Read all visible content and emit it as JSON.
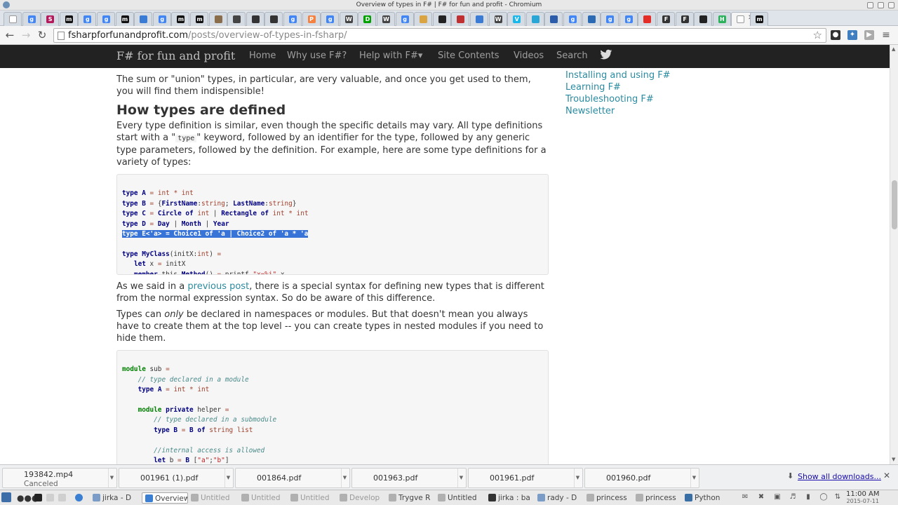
{
  "window": {
    "title": "Overview of types in F# | F# for fun and profit - Chromium"
  },
  "tabs": [
    {
      "favicon_color": "#ffffff",
      "favicon_icon": "page-icon"
    },
    {
      "favicon_color": "#4285f4",
      "favicon_icon": "google-icon",
      "letter": "g"
    },
    {
      "favicon_color": "#b3195b",
      "favicon_icon": "s-icon",
      "letter": "S"
    },
    {
      "favicon_color": "#111111",
      "favicon_icon": "m-icon",
      "letter": "m"
    },
    {
      "favicon_color": "#4285f4",
      "favicon_icon": "google-icon",
      "letter": "g"
    },
    {
      "favicon_color": "#4285f4",
      "favicon_icon": "google-icon",
      "letter": "g"
    },
    {
      "favicon_color": "#111111",
      "favicon_icon": "m-icon",
      "letter": "m"
    },
    {
      "favicon_color": "#3a7bd5",
      "favicon_icon": "tool-icon",
      "letter": ""
    },
    {
      "favicon_color": "#4285f4",
      "favicon_icon": "google-icon",
      "letter": "g"
    },
    {
      "favicon_color": "#111111",
      "favicon_icon": "m-icon",
      "letter": "m"
    },
    {
      "favicon_color": "#111111",
      "favicon_icon": "m-icon",
      "letter": "m"
    },
    {
      "favicon_color": "#8a6d4b",
      "favicon_icon": "person-icon",
      "letter": ""
    },
    {
      "favicon_color": "#444444",
      "favicon_icon": "gear-icon",
      "letter": ""
    },
    {
      "favicon_color": "#333333",
      "favicon_icon": "feather-icon",
      "letter": ""
    },
    {
      "favicon_color": "#333333",
      "favicon_icon": "feather-icon",
      "letter": ""
    },
    {
      "favicon_color": "#4285f4",
      "favicon_icon": "google-icon",
      "letter": "g"
    },
    {
      "favicon_color": "#f4813f",
      "favicon_icon": "p-icon",
      "letter": "P"
    },
    {
      "favicon_color": "#4285f4",
      "favicon_icon": "google-icon",
      "letter": "g"
    },
    {
      "favicon_color": "#444444",
      "favicon_icon": "w-icon",
      "letter": "W"
    },
    {
      "favicon_color": "#00a000",
      "favicon_icon": "d-icon",
      "letter": "D"
    },
    {
      "favicon_color": "#444444",
      "favicon_icon": "w-icon",
      "letter": "W"
    },
    {
      "favicon_color": "#4285f4",
      "favicon_icon": "google-icon",
      "letter": "g"
    },
    {
      "favicon_color": "#d9a441",
      "favicon_icon": "hat-icon",
      "letter": ""
    },
    {
      "favicon_color": "#222222",
      "favicon_icon": "github-icon",
      "letter": ""
    },
    {
      "favicon_color": "#c03030",
      "favicon_icon": "slash-icon",
      "letter": ""
    },
    {
      "favicon_color": "#3a7bd5",
      "favicon_icon": "swirl-icon",
      "letter": ""
    },
    {
      "favicon_color": "#444444",
      "favicon_icon": "w-icon",
      "letter": "W"
    },
    {
      "favicon_color": "#1ab7ea",
      "favicon_icon": "v-icon",
      "letter": "V"
    },
    {
      "favicon_color": "#2aa6d6",
      "favicon_icon": "pause-icon",
      "letter": ""
    },
    {
      "favicon_color": "#2a5caa",
      "favicon_icon": "blob-icon",
      "letter": ""
    },
    {
      "favicon_color": "#4285f4",
      "favicon_icon": "google-icon",
      "letter": "g"
    },
    {
      "favicon_color": "#2a6ab5",
      "favicon_icon": "doc-icon",
      "letter": ""
    },
    {
      "favicon_color": "#4285f4",
      "favicon_icon": "google-icon",
      "letter": "g"
    },
    {
      "favicon_color": "#4285f4",
      "favicon_icon": "google-icon",
      "letter": "g"
    },
    {
      "favicon_color": "#e52d27",
      "favicon_icon": "youtube-icon",
      "letter": ""
    },
    {
      "favicon_color": "#333333",
      "favicon_icon": "fs-icon",
      "letter": "F"
    },
    {
      "favicon_color": "#333333",
      "favicon_icon": "fs-icon",
      "letter": "F"
    },
    {
      "favicon_color": "#222222",
      "favicon_icon": "github-icon",
      "letter": ""
    },
    {
      "favicon_color": "#2ab25a",
      "favicon_icon": "h-icon",
      "letter": "H"
    },
    {
      "favicon_color": "#ffffff",
      "favicon_icon": "active-tab-icon",
      "letter": "",
      "active": true
    },
    {
      "favicon_color": "#111111",
      "favicon_icon": "m-icon",
      "letter": "m"
    }
  ],
  "toolbar": {
    "url_domain": "fsharpforfunandprofit.com",
    "url_path": "/posts/overview-of-types-in-fsharp/",
    "back_icon": "back-arrow-icon",
    "forward_icon": "forward-arrow-icon",
    "reload_icon": "reload-icon",
    "star_icon": "star-icon",
    "extensions": [
      {
        "icon": "pocket-icon",
        "color": "#333333"
      },
      {
        "icon": "tools-icon",
        "color": "#3f7fc0"
      },
      {
        "icon": "megaphone-icon",
        "color": "#aaaaaa"
      },
      {
        "icon": "menu-icon",
        "color": "#555555"
      }
    ]
  },
  "site": {
    "brand": "F# for fun and profit",
    "nav": [
      "Home",
      "Why use F#?",
      "Help with F#▾",
      "Site Contents",
      "Videos",
      "Search"
    ],
    "twitter_icon": "twitter-icon"
  },
  "article": {
    "p1": "The sum or \"union\" types, in particular, are very valuable, and once you get used to them, you will find them indispensible!",
    "heading": "How types are defined",
    "p2_before": "Every type definition is similar, even though the specific details may vary. All type definitions start with a \"",
    "p2_kw": "type",
    "p2_after": "\" keyword, followed by an identifier for the type, followed by any generic type parameters, followed by the definition. For example, here are some type definitions for a variety of types:",
    "p3_before": "As we said in a ",
    "p3_link": "previous post",
    "p3_after": ", there is a special syntax for defining new types that is different from the normal expression syntax. So do be aware of this difference.",
    "p4_before": "Types can ",
    "p4_em": "only",
    "p4_after": " be declared in namespaces or modules. But that doesn't mean you always have to create them at the top level -- you can create types in nested modules if you need to hide them."
  },
  "sidebar": {
    "links": [
      "Installing and using F#",
      "Learning F#",
      "Troubleshooting F#",
      "Newsletter"
    ]
  },
  "downloads": {
    "items": [
      {
        "name": "193842.mp4",
        "status": "Canceled"
      },
      {
        "name": "001961 (1).pdf",
        "status": ""
      },
      {
        "name": "001864.pdf",
        "status": ""
      },
      {
        "name": "001963.pdf",
        "status": ""
      },
      {
        "name": "001961.pdf",
        "status": ""
      },
      {
        "name": "001960.pdf",
        "status": ""
      }
    ],
    "show_all": "Show all downloads...",
    "close_icon": "close-icon"
  },
  "taskbar": {
    "items": [
      {
        "label": "jirka - D",
        "icon": "folder-icon",
        "color": "#7a9cc6",
        "muted": false
      },
      {
        "label": "Overview",
        "icon": "chromium-icon",
        "color": "#3b7fd3",
        "muted": false,
        "active": true
      },
      {
        "label": "Untitled",
        "icon": "doc-icon",
        "color": "#b0b0b0",
        "muted": true
      },
      {
        "label": "Untitled",
        "icon": "doc-icon",
        "color": "#b0b0b0",
        "muted": true
      },
      {
        "label": "Untitled",
        "icon": "doc-icon",
        "color": "#b0b0b0",
        "muted": true
      },
      {
        "label": "Develop",
        "icon": "doc-icon",
        "color": "#b0b0b0",
        "muted": true
      },
      {
        "label": "Trygve R",
        "icon": "doc-icon",
        "color": "#b0b0b0",
        "muted": false
      },
      {
        "label": "Untitled",
        "icon": "doc-icon",
        "color": "#b0b0b0",
        "muted": false
      },
      {
        "label": "jirka : ba",
        "icon": "terminal-icon",
        "color": "#333333",
        "muted": false
      },
      {
        "label": "rady - D",
        "icon": "folder-icon",
        "color": "#7a9cc6",
        "muted": false
      },
      {
        "label": "princess",
        "icon": "doc-icon",
        "color": "#b0b0b0",
        "muted": false
      },
      {
        "label": "princess",
        "icon": "doc-icon",
        "color": "#b0b0b0",
        "muted": false
      },
      {
        "label": "Python",
        "icon": "python-icon",
        "color": "#3a6fa5",
        "muted": false
      }
    ],
    "time": "11:00 AM",
    "date": "2015-07-11"
  }
}
